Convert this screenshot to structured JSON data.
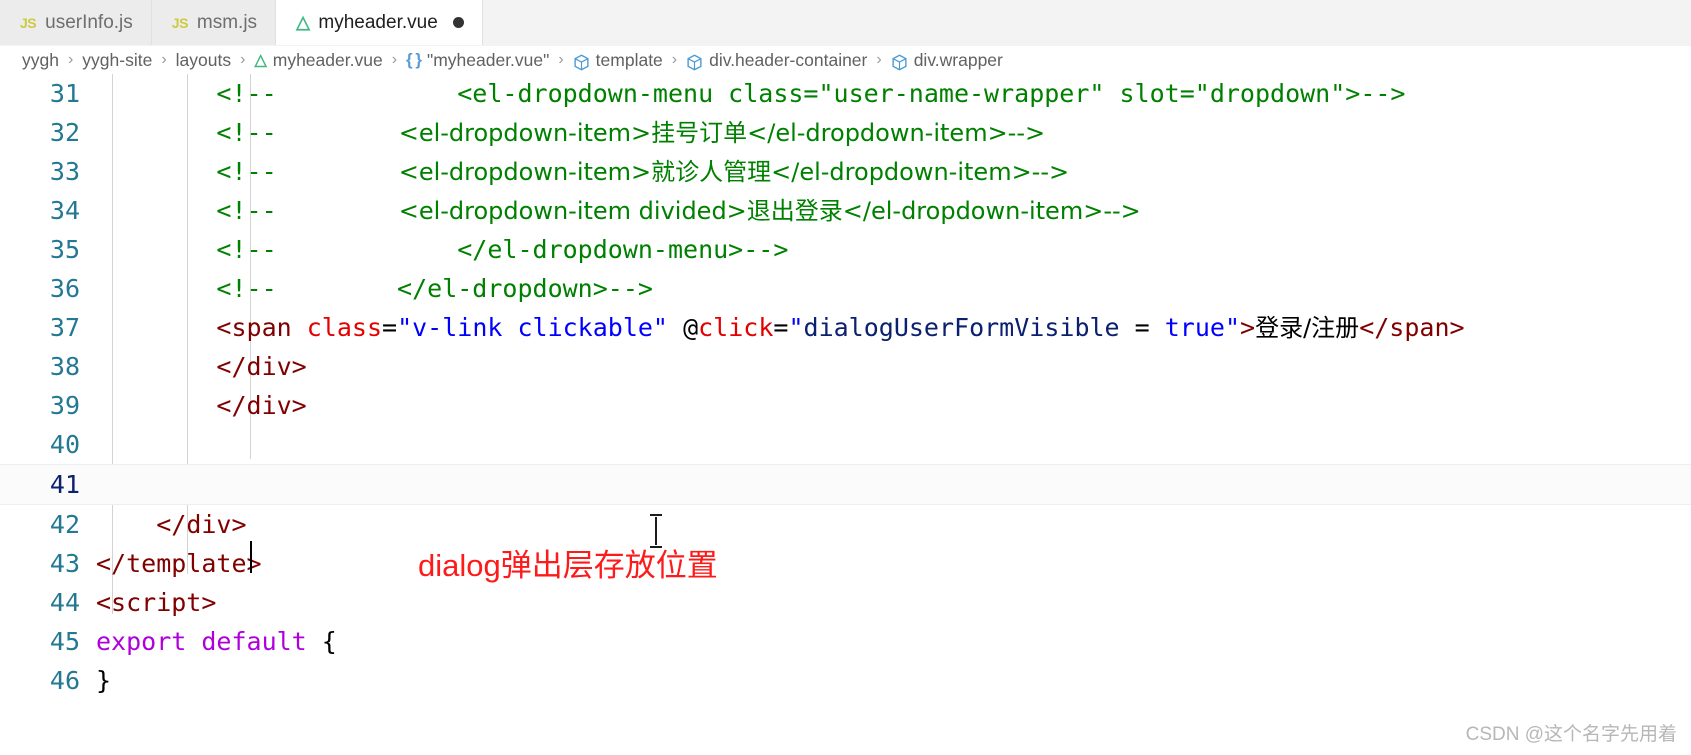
{
  "window": {
    "app": "vscode-editor",
    "active_file": "myheader.vue"
  },
  "tabs": [
    {
      "label": "userInfo.js",
      "icon": "js-file-icon",
      "icon_text": "JS",
      "active": false,
      "dirty": false
    },
    {
      "label": "msm.js",
      "icon": "js-file-icon",
      "icon_text": "JS",
      "active": false,
      "dirty": false
    },
    {
      "label": "myheader.vue",
      "icon": "vue-file-icon",
      "icon_text": "V",
      "active": true,
      "dirty": true
    }
  ],
  "breadcrumb": [
    {
      "label": "yygh",
      "icon": "none"
    },
    {
      "label": "yygh-site",
      "icon": "none"
    },
    {
      "label": "layouts",
      "icon": "none"
    },
    {
      "label": "myheader.vue",
      "icon": "vue-file-icon"
    },
    {
      "label": "\"myheader.vue\"",
      "icon": "braces-icon"
    },
    {
      "label": "template",
      "icon": "symbol-cube-icon"
    },
    {
      "label": "div.header-container",
      "icon": "symbol-cube-icon"
    },
    {
      "label": "div.wrapper",
      "icon": "symbol-cube-icon"
    }
  ],
  "breadcrumb_separator": "›",
  "editor": {
    "language": "vue",
    "first_line": 31,
    "current_line": 41,
    "lines": [
      {
        "no": "31",
        "tokens": [
          {
            "t": "        ",
            "c": "plain"
          },
          {
            "t": "<!--",
            "c": "comment"
          },
          {
            "t": "            <el-dropdown-menu class=\"user-name-wrapper\" slot=\"dropdown\">-->",
            "c": "comment"
          }
        ]
      },
      {
        "no": "32",
        "tokens": [
          {
            "t": "        ",
            "c": "plain"
          },
          {
            "t": "<!--",
            "c": "comment"
          },
          {
            "t": "                <el-dropdown-item>挂号订单</el-dropdown-item>-->",
            "c": "comment"
          }
        ]
      },
      {
        "no": "33",
        "tokens": [
          {
            "t": "        ",
            "c": "plain"
          },
          {
            "t": "<!--",
            "c": "comment"
          },
          {
            "t": "                <el-dropdown-item>就诊人管理</el-dropdown-item>-->",
            "c": "comment"
          }
        ]
      },
      {
        "no": "34",
        "tokens": [
          {
            "t": "        ",
            "c": "plain"
          },
          {
            "t": "<!--",
            "c": "comment"
          },
          {
            "t": "                <el-dropdown-item divided>退出登录</el-dropdown-item>-->",
            "c": "comment"
          }
        ]
      },
      {
        "no": "35",
        "tokens": [
          {
            "t": "        ",
            "c": "plain"
          },
          {
            "t": "<!--",
            "c": "comment"
          },
          {
            "t": "            </el-dropdown-menu>-->",
            "c": "comment"
          }
        ]
      },
      {
        "no": "36",
        "tokens": [
          {
            "t": "        ",
            "c": "plain"
          },
          {
            "t": "<!--",
            "c": "comment"
          },
          {
            "t": "        </el-dropdown>-->",
            "c": "comment"
          }
        ]
      },
      {
        "no": "37",
        "tokens": [
          {
            "t": "        ",
            "c": "plain"
          },
          {
            "t": "<span ",
            "c": "tag"
          },
          {
            "t": "class",
            "c": "attr"
          },
          {
            "t": "=",
            "c": "punct"
          },
          {
            "t": "\"v-link clickable\"",
            "c": "str"
          },
          {
            "t": " ",
            "c": "plain"
          },
          {
            "t": "@",
            "c": "punct"
          },
          {
            "t": "click",
            "c": "attr"
          },
          {
            "t": "=",
            "c": "punct"
          },
          {
            "t": "\"",
            "c": "str"
          },
          {
            "t": "dialogUserFormVisible",
            "c": "strdark"
          },
          {
            "t": " = ",
            "c": "punct"
          },
          {
            "t": "true",
            "c": "str"
          },
          {
            "t": "\"",
            "c": "str"
          },
          {
            "t": ">",
            "c": "tag"
          },
          {
            "t": "登录/注册",
            "c": "plain"
          },
          {
            "t": "</span>",
            "c": "tag"
          }
        ]
      },
      {
        "no": "38",
        "tokens": [
          {
            "t": "        ",
            "c": "plain"
          },
          {
            "t": "</div>",
            "c": "tag"
          }
        ]
      },
      {
        "no": "39",
        "tokens": [
          {
            "t": "        ",
            "c": "plain"
          },
          {
            "t": "</div>",
            "c": "tag"
          }
        ]
      },
      {
        "no": "40",
        "tokens": []
      },
      {
        "no": "41",
        "tokens": []
      },
      {
        "no": "42",
        "tokens": [
          {
            "t": "    ",
            "c": "plain"
          },
          {
            "t": "</div>",
            "c": "tag"
          }
        ]
      },
      {
        "no": "43",
        "tokens": [
          {
            "t": "</template>",
            "c": "tag"
          }
        ]
      },
      {
        "no": "44",
        "tokens": [
          {
            "t": "<script>",
            "c": "tag"
          }
        ]
      },
      {
        "no": "45",
        "tokens": [
          {
            "t": "export default",
            "c": "kw"
          },
          {
            "t": " {",
            "c": "punct"
          }
        ]
      },
      {
        "no": "46",
        "tokens": [
          {
            "t": "}",
            "c": "punct"
          }
        ]
      }
    ]
  },
  "annotation": {
    "text": "dialog弹出层存放位置",
    "color": "#ff1a1a"
  },
  "watermark": {
    "text": "CSDN @这个名字先用着"
  },
  "colors": {
    "comment": "#008000",
    "tag": "#800000",
    "attribute": "#e50000",
    "string": "#0000ff",
    "keyword": "#af00db",
    "line_number": "#237893",
    "annotation_red": "#ff1a1a",
    "vue_green": "#41b883",
    "js_yellow": "#cbcb41"
  }
}
